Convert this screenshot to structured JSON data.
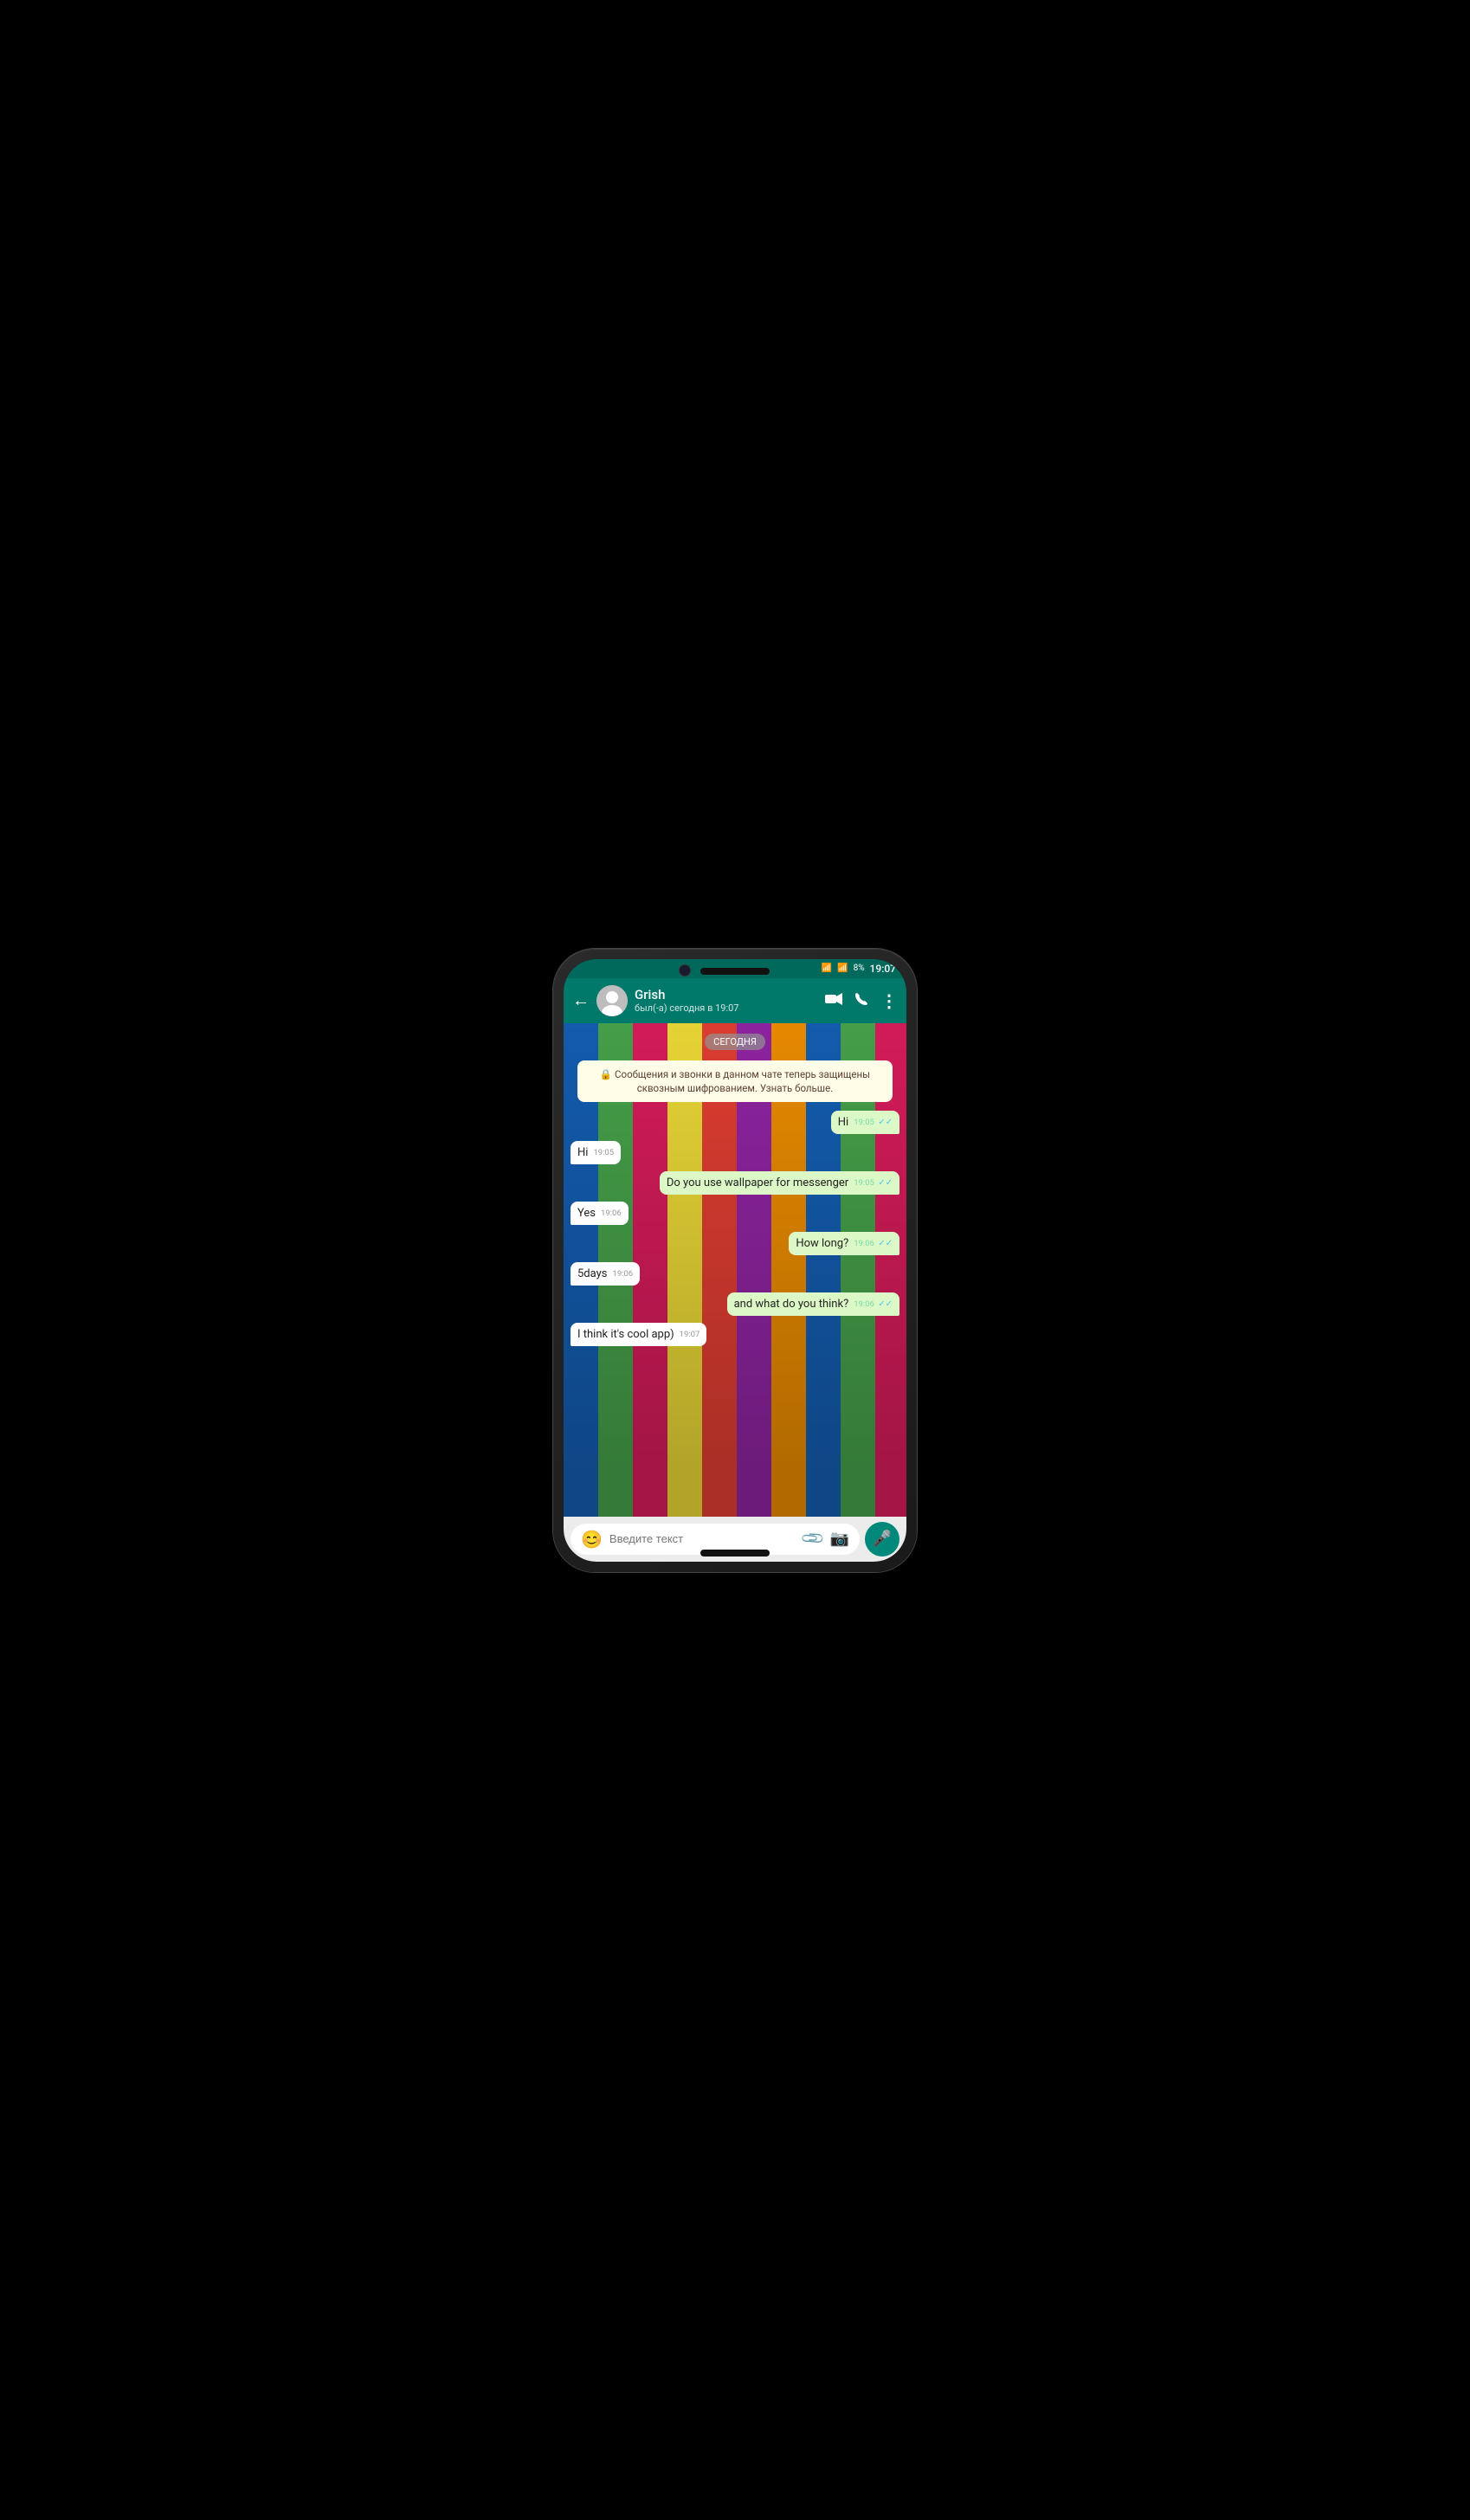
{
  "statusBar": {
    "wifi": "📶",
    "signal": "📶",
    "battery": "8%",
    "time": "19:07"
  },
  "header": {
    "backLabel": "←",
    "contactName": "Grish",
    "contactStatus": "был(-а) сегодня в 19:07",
    "videoIcon": "📹",
    "phoneIcon": "📞",
    "moreIcon": "⋮"
  },
  "chat": {
    "dateBadge": "СЕГОДНЯ",
    "encryptionNotice": "🔒 Сообщения и звонки в данном чате теперь защищены сквозным шифрованием. Узнать больше.",
    "messages": [
      {
        "id": 1,
        "type": "sent",
        "text": "Hi",
        "time": "19:05",
        "read": true
      },
      {
        "id": 2,
        "type": "received",
        "text": "Hi",
        "time": "19:05"
      },
      {
        "id": 3,
        "type": "sent",
        "text": "Do you use wallpaper for messenger",
        "time": "19:05",
        "read": true
      },
      {
        "id": 4,
        "type": "received",
        "text": "Yes",
        "time": "19:06"
      },
      {
        "id": 5,
        "type": "sent",
        "text": "How long?",
        "time": "19:06",
        "read": true
      },
      {
        "id": 6,
        "type": "received",
        "text": "5days",
        "time": "19:06"
      },
      {
        "id": 7,
        "type": "sent",
        "text": "and what do you think?",
        "time": "19:06",
        "read": true
      },
      {
        "id": 8,
        "type": "received",
        "text": "I think it's cool app)",
        "time": "19:07"
      }
    ]
  },
  "inputBar": {
    "placeholder": "Введите текст",
    "emojiIcon": "😊",
    "attachIcon": "📎",
    "cameraIcon": "📷",
    "micIcon": "🎤"
  }
}
